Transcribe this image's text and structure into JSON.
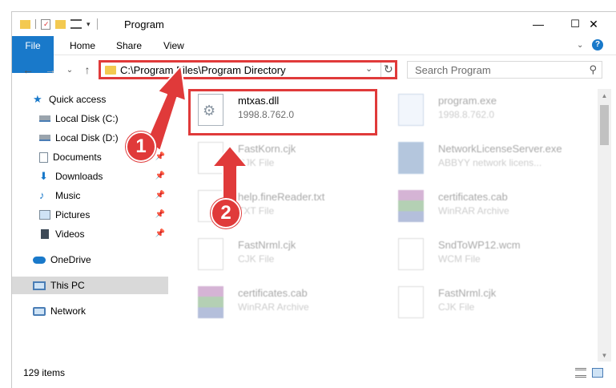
{
  "window": {
    "title": "Program",
    "controls": {
      "minimize": "—",
      "maximize": "☐",
      "close": "✕"
    }
  },
  "ribbon": {
    "tabs": [
      {
        "label": "File"
      },
      {
        "label": "Home"
      },
      {
        "label": "Share"
      },
      {
        "label": "View"
      }
    ],
    "help_icon": "?"
  },
  "address": {
    "path": "C:\\Program Files\\Program Directory",
    "dropdown": "⌄",
    "refresh": "↻"
  },
  "search": {
    "placeholder": "Search Program",
    "icon": "⚲"
  },
  "nav": {
    "back": "←",
    "forward": "→",
    "recent": "⌄",
    "up": "↑"
  },
  "sidebar": {
    "items": [
      {
        "label": "Quick access",
        "icon": "star-icon"
      },
      {
        "label": "Local Disk (C:)",
        "icon": "drive-icon"
      },
      {
        "label": "Local Disk (D:)",
        "icon": "drive-icon"
      },
      {
        "label": "Documents",
        "icon": "documents-icon"
      },
      {
        "label": "Downloads",
        "icon": "download-icon"
      },
      {
        "label": "Music",
        "icon": "music-icon"
      },
      {
        "label": "Pictures",
        "icon": "pictures-icon"
      },
      {
        "label": "Videos",
        "icon": "videos-icon"
      },
      {
        "label": "OneDrive",
        "icon": "cloud-icon"
      },
      {
        "label": "This PC",
        "icon": "pc-icon"
      },
      {
        "label": "Network",
        "icon": "network-icon"
      }
    ]
  },
  "files": [
    {
      "name": "mtxas.dll",
      "sub": "1998.8.762.0"
    },
    {
      "name": "program.exe",
      "sub": "1998.8.762.0"
    },
    {
      "name": "FastKorn.cjk",
      "sub": "CJK File"
    },
    {
      "name": "NetworkLicenseServer.exe",
      "sub": "ABBYY network licens..."
    },
    {
      "name": "help.fineReader.txt",
      "sub": "TXT File"
    },
    {
      "name": "certificates.cab",
      "sub": "WinRAR Archive"
    },
    {
      "name": "FastNrml.cjk",
      "sub": "CJK File"
    },
    {
      "name": "SndToWP12.wcm",
      "sub": "WCM File"
    },
    {
      "name": "certificates.cab",
      "sub": "WinRAR Archive"
    },
    {
      "name": "FastNrml.cjk",
      "sub": "CJK File"
    }
  ],
  "status": {
    "count": "129 items"
  },
  "callouts": {
    "one": "1",
    "two": "2"
  }
}
